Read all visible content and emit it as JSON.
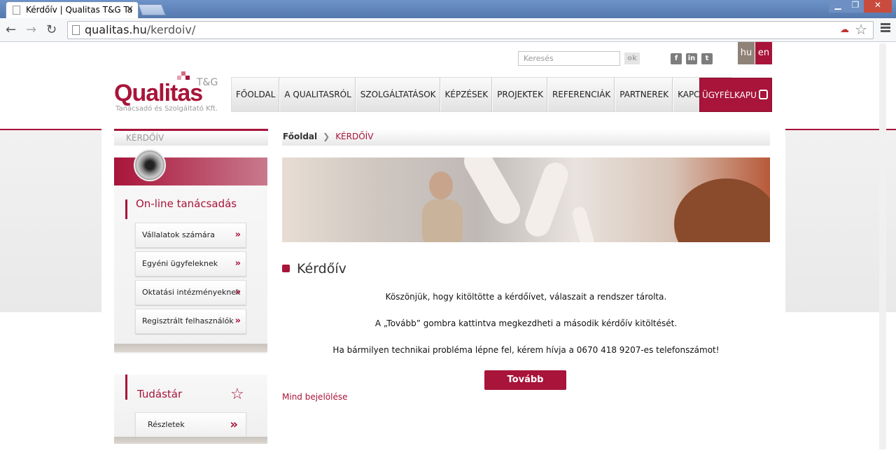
{
  "browser": {
    "tab_title": "Kérdőív | Qualitas T&G Ta",
    "url_domain": "qualitas.hu",
    "url_path": "/kerdoiv/"
  },
  "header": {
    "search_placeholder": "Keresés",
    "search_button": "ok",
    "social": [
      "f",
      "in",
      "t"
    ],
    "languages": [
      {
        "code": "hu",
        "color": "#8f8378"
      },
      {
        "code": "en",
        "color": "#a8143a"
      }
    ],
    "logo_main": "Qualitas",
    "logo_tg": "T&G",
    "logo_sub": "Tanácsadó és Szolgáltató Kft."
  },
  "nav": {
    "items": [
      "FŐOLDAL",
      "A QUALITASRÓL",
      "SZOLGÁLTATÁSOK",
      "KÉPZÉSEK",
      "PROJEKTEK",
      "REFERENCIÁK",
      "PARTNEREK",
      "KAPCSOLAT"
    ],
    "client_portal": "ÜGYFÉLKAPU"
  },
  "sidebar": {
    "heading": "KÉRDŐÍV",
    "online_title": "On-line tanácsadás",
    "items": [
      "Vállalatok számára",
      "Egyéni ügyfeleknek",
      "Oktatási intézményeknek",
      "Regisztrált felhasználók"
    ],
    "knowledge_title": "Tudástár",
    "details": "Részletek"
  },
  "breadcrumb": {
    "home": "Főoldal",
    "current": "KÉRDŐÍV"
  },
  "main": {
    "title": "Kérdőív",
    "message1": "Köszönjük, hogy kitöltötte a kérdőívet, válaszait a rendszer tárolta.",
    "message2": "A „Tovább” gombra kattintva megkezdheti a második kérdőív kitöltését.",
    "message3": "Ha bármilyen technikai probléma lépne fel, kérem hívja a 0670 418 9207-es telefonszámot!",
    "next_button": "Tovább",
    "mark_all": "Mind bejelölése"
  },
  "colors": {
    "brand": "#a8143a",
    "gray": "#8f8378"
  }
}
